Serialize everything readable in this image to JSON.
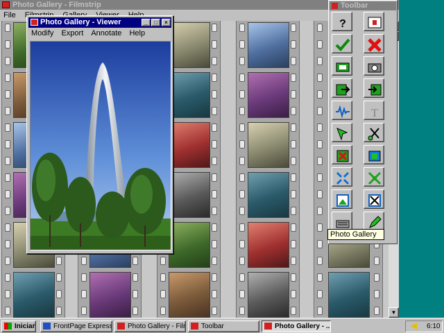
{
  "main_window": {
    "title": "Photo Gallery - Filmstrip",
    "menu": [
      "File",
      "Filmstrip",
      "Gallery",
      "Viewer",
      "Help"
    ]
  },
  "viewer_window": {
    "title": "Photo Gallery - Viewer",
    "menu": [
      "Modify",
      "Export",
      "Annotate",
      "Help"
    ],
    "photo_subject": "Gateway Arch with trees"
  },
  "toolbar_window": {
    "title": "Toolbar",
    "tools": [
      {
        "icon": "help-icon"
      },
      {
        "icon": "slideshow-icon"
      },
      {
        "icon": "accept-icon"
      },
      {
        "icon": "delete-icon"
      },
      {
        "icon": "film-icon"
      },
      {
        "icon": "camera-icon"
      },
      {
        "icon": "import-icon"
      },
      {
        "icon": "export-icon"
      },
      {
        "icon": "waveform-icon"
      },
      {
        "icon": "text-icon"
      },
      {
        "icon": "pointer-icon"
      },
      {
        "icon": "scissors-icon"
      },
      {
        "icon": "remove-icon"
      },
      {
        "icon": "crop-icon"
      },
      {
        "icon": "shrink-icon"
      },
      {
        "icon": "expand-icon"
      },
      {
        "icon": "frame-icon"
      },
      {
        "icon": "frame-cut-icon"
      },
      {
        "icon": "scanner-icon"
      },
      {
        "icon": "edit-icon"
      }
    ],
    "tooltip": "Photo Gallery"
  },
  "taskbar": {
    "start_label": "Iniciar",
    "tasks": [
      {
        "label": "FrontPage Express ...",
        "active": false
      },
      {
        "label": "Photo Gallery - Films...",
        "active": false
      },
      {
        "label": "Toolbar",
        "active": false
      },
      {
        "label": "Photo Gallery - ...",
        "active": true
      }
    ],
    "clock": "6:10"
  },
  "colors": {
    "active_title": "#000080",
    "inactive_title": "#808080",
    "face": "#c0c0c0",
    "tooltip_bg": "#ffffe1"
  }
}
